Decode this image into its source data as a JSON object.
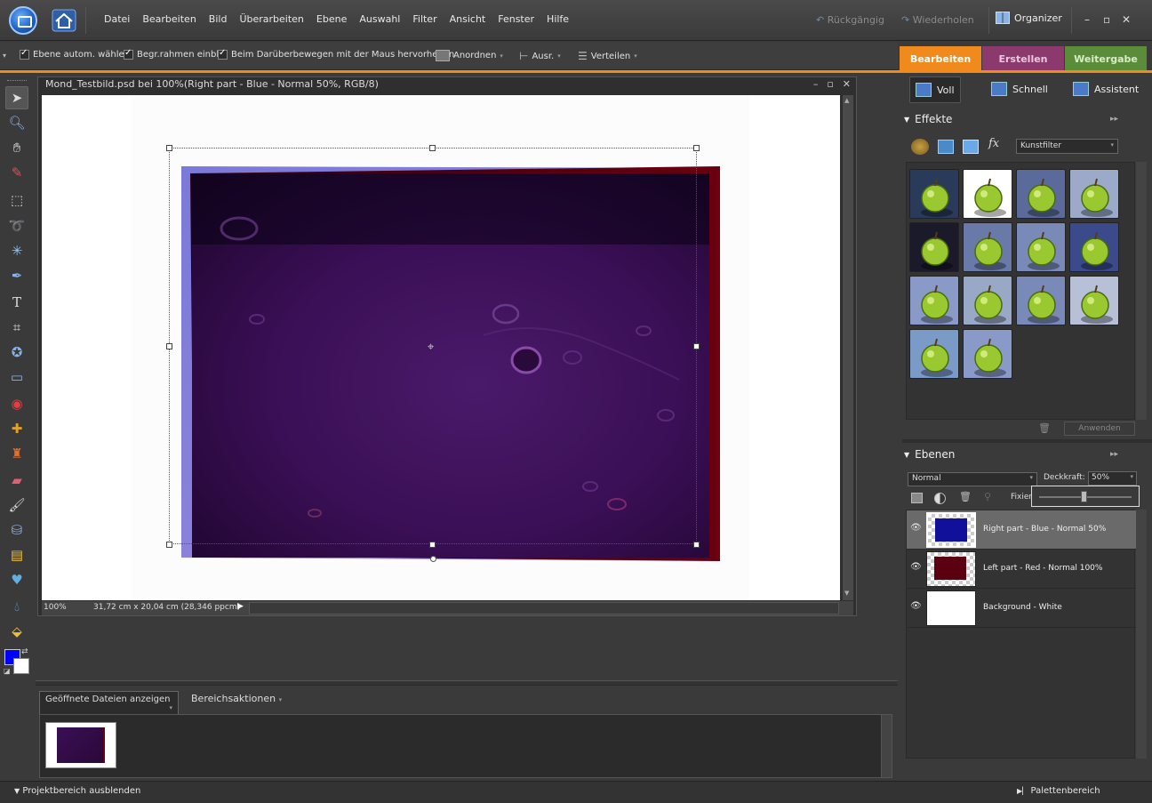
{
  "menubar": {
    "items": [
      "Datei",
      "Bearbeiten",
      "Bild",
      "Überarbeiten",
      "Ebene",
      "Auswahl",
      "Filter",
      "Ansicht",
      "Fenster",
      "Hilfe"
    ],
    "undo": "Rückgängig",
    "redo": "Wiederholen",
    "organizer": "Organizer"
  },
  "options": {
    "auto_select": "Ebene autom. wählen",
    "bounding_box": "Begr.rahmen einbl.",
    "highlight": "Beim Darüberbewegen mit der Maus hervorheben",
    "arrange": "Anordnen",
    "align": "Ausr.",
    "distribute": "Verteilen"
  },
  "modes": {
    "edit": "Bearbeiten",
    "create": "Erstellen",
    "share": "Weitergabe",
    "colors": {
      "edit": "#f08a1c",
      "create": "#8c3a6e",
      "share": "#5b8c3a"
    }
  },
  "document": {
    "title": "Mond_Testbild.psd bei 100%(Right part - Blue - Normal 50%, RGB/8)",
    "zoom": "100%",
    "size": "31,72 cm x 20,04 cm (28,346 ppcm)"
  },
  "right": {
    "tab_full": "Voll",
    "tab_quick": "Schnell",
    "tab_guided": "Assistent",
    "effects_title": "Effekte",
    "filter_select": "Kunstfilter",
    "apply": "Anwenden",
    "layers_title": "Ebenen",
    "blend_mode": "Normal",
    "opacity_label": "Deckkraft:",
    "opacity_value": "50%",
    "fix_label": "Fixier",
    "layers": [
      {
        "name": "Right part - Blue - Normal 50%"
      },
      {
        "name": "Left part - Red - Normal 100%"
      },
      {
        "name": "Background - White"
      }
    ]
  },
  "bin": {
    "show_files": "Geöffnete Dateien anzeigen",
    "actions": "Bereichsaktionen"
  },
  "bottom": {
    "hide_project": "Projektbereich ausblenden",
    "palette": "Palettenbereich"
  }
}
